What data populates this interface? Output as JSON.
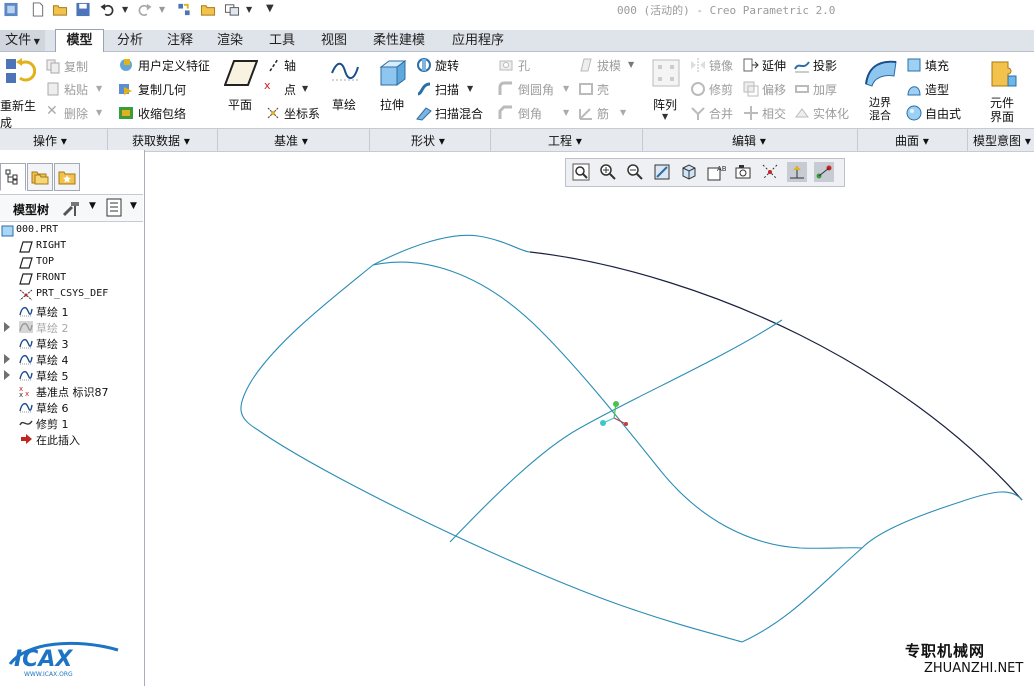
{
  "window": {
    "title": "000 (活动的) - Creo Parametric 2.0"
  },
  "tabs": [
    {
      "label": "文件",
      "has_menu": true
    },
    {
      "label": "模型",
      "active": true
    },
    {
      "label": "分析"
    },
    {
      "label": "注释"
    },
    {
      "label": "渲染"
    },
    {
      "label": "工具"
    },
    {
      "label": "视图"
    },
    {
      "label": "柔性建模"
    },
    {
      "label": "应用程序"
    }
  ],
  "ribbon": {
    "operations": {
      "regenerate": "重新生成",
      "copy": "复制",
      "paste": "粘贴",
      "delete": "删除",
      "group": "操作"
    },
    "get_data": {
      "user_feature": "用户定义特征",
      "copy_geometry": "复制几何",
      "shrinkwrap": "收缩包络",
      "group": "获取数据"
    },
    "datum": {
      "plane": "平面",
      "axis": "轴",
      "point": "点",
      "csys": "坐标系",
      "sketch": "草绘",
      "group": "基准"
    },
    "shapes": {
      "extrude": "拉伸",
      "revolve": "旋转",
      "sweep": "扫描",
      "swept_blend": "扫描混合",
      "group": "形状"
    },
    "engineering": {
      "hole": "孔",
      "round": "倒圆角",
      "chamfer": "倒角",
      "draft": "拔模",
      "shell": "壳",
      "rib": "筋",
      "group": "工程"
    },
    "editing": {
      "pattern": "阵列",
      "mirror": "镜像",
      "trim": "修剪",
      "merge": "合并",
      "extend": "延伸",
      "offset": "偏移",
      "intersect": "相交",
      "project": "投影",
      "thicken": "加厚",
      "solidify": "实体化",
      "group": "编辑"
    },
    "surfaces": {
      "boundary_blend": "边界混合",
      "fill": "填充",
      "style": "造型",
      "freestyle": "自由式",
      "group": "曲面"
    },
    "model_intent": {
      "component_interface": "元件界面",
      "group": "模型意图"
    }
  },
  "model_tree": {
    "title": "模型树",
    "items": [
      {
        "label": "000.PRT",
        "icon": "part-icon"
      },
      {
        "label": "RIGHT",
        "icon": "datum-plane-icon"
      },
      {
        "label": "TOP",
        "icon": "datum-plane-icon"
      },
      {
        "label": "FRONT",
        "icon": "datum-plane-icon"
      },
      {
        "label": "PRT_CSYS_DEF",
        "icon": "csys-icon"
      },
      {
        "label": "草绘 1",
        "icon": "sketch-icon"
      },
      {
        "label": "草绘 2",
        "icon": "sketch-hidden-icon",
        "dim": true,
        "expandable": true
      },
      {
        "label": "草绘 3",
        "icon": "sketch-icon"
      },
      {
        "label": "草绘 4",
        "icon": "sketch-icon",
        "expandable": true
      },
      {
        "label": "草绘 5",
        "icon": "sketch-icon",
        "expandable": true
      },
      {
        "label": "基准点 标识87",
        "icon": "datum-point-icon"
      },
      {
        "label": "草绘 6",
        "icon": "sketch-icon"
      },
      {
        "label": "修剪 1",
        "icon": "trim-icon"
      },
      {
        "label": "在此插入",
        "icon": "insert-arrow-icon"
      }
    ]
  },
  "watermark": {
    "site_cn": "专职机械网",
    "site_url": "ZHUANZHI.NET",
    "logo_text": "ICAX",
    "logo_url": "WWW.ICAX.ORG"
  },
  "colors": {
    "curve": "#2a8db5",
    "edge": "#1a2040",
    "accent": "#f2b51d"
  }
}
